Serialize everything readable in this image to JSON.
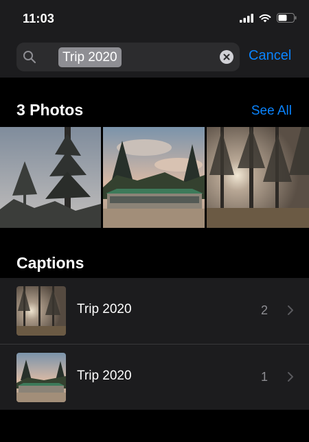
{
  "status": {
    "time": "11:03"
  },
  "search": {
    "query": "Trip 2020",
    "cancel_label": "Cancel"
  },
  "photos_section": {
    "title": "3 Photos",
    "see_all_label": "See All",
    "photos": [
      {
        "name": "tall-pine-against-sky-photo"
      },
      {
        "name": "green-roof-building-with-trees-photo"
      },
      {
        "name": "sunset-through-forest-photo"
      }
    ]
  },
  "captions_section": {
    "title": "Captions",
    "items": [
      {
        "label": "Trip 2020",
        "count": "2",
        "icon": "chevron-right-icon"
      },
      {
        "label": "Trip 2020",
        "count": "1",
        "icon": "chevron-right-icon"
      }
    ]
  },
  "colors": {
    "accent": "#0a84ff",
    "background": "#000000",
    "surface": "#1c1c1e",
    "secondary_text": "#8e8e93"
  }
}
